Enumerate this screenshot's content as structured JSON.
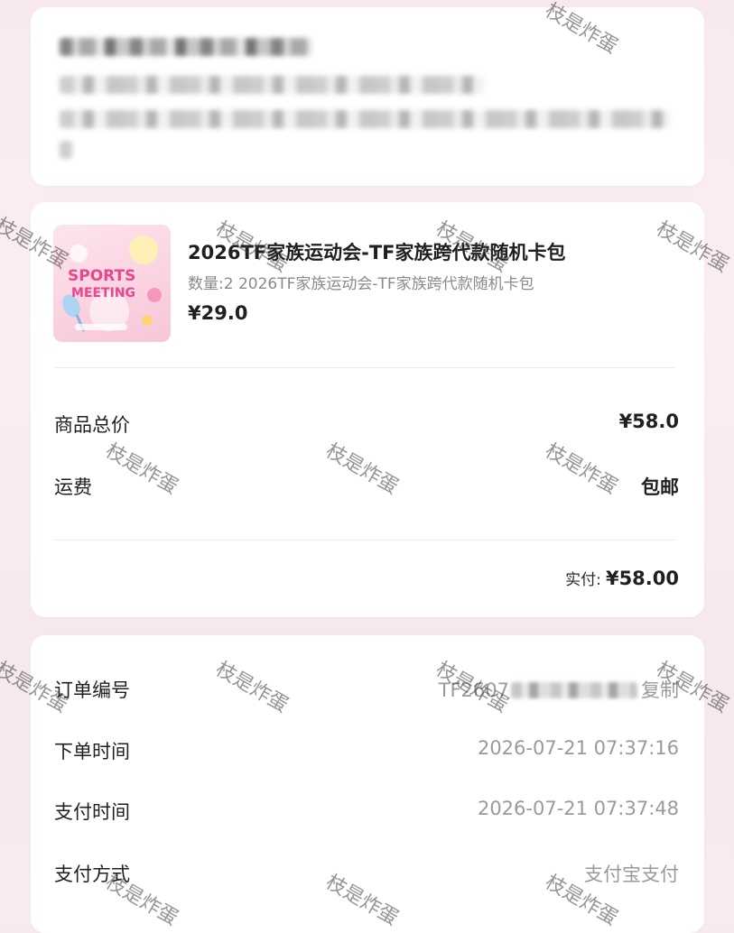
{
  "product": {
    "title": "2026TF家族运动会-TF家族跨代款随机卡包",
    "subtitle": "数量:2 2026TF家族运动会-TF家族跨代款随机卡包",
    "price": "¥29.0",
    "image_text": "SPORTS MEETING"
  },
  "summary": {
    "goods_total_label": "商品总价",
    "goods_total_value": "¥58.0",
    "shipping_label": "运费",
    "shipping_value": "包邮",
    "paid_label": "实付:",
    "paid_value": "¥58.00"
  },
  "order": {
    "order_no_label": "订单编号",
    "order_no_value": "TF2607",
    "copy_label": "复制",
    "order_time_label": "下单时间",
    "order_time_value": "2026-07-21 07:37:16",
    "pay_time_label": "支付时间",
    "pay_time_value": "2026-07-21 07:37:48",
    "pay_method_label": "支付方式",
    "pay_method_value": "支付宝支付"
  },
  "watermark": {
    "text": "枝是炸蛋"
  }
}
